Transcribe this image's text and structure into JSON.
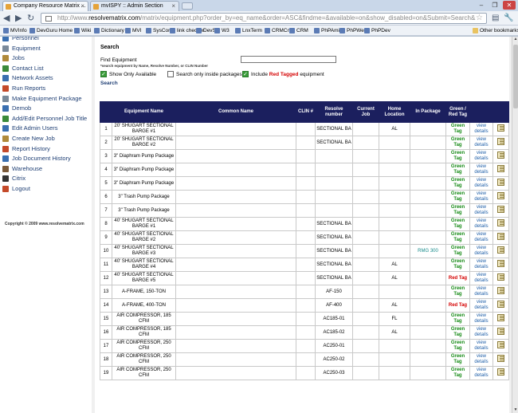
{
  "browser": {
    "tabs": [
      {
        "title": "Company Resource Matrix ..."
      },
      {
        "title": "mvISPY :: Admin Section"
      }
    ],
    "url_prefix": "http://www.",
    "url_domain": "resolvematrix.com",
    "url_rest": "/matrix/equipment.php?order_by=eq_name&order=ASC&findme=&available=on&show_disabled=on&Submit=Search&",
    "bookmarks": [
      "MVInfo",
      "DevGuru Home",
      "Wiki",
      "Dictionary",
      "MVI",
      "SysCon",
      "link checker",
      "DevSrv",
      "W3",
      "LnxTerm",
      "CRMCnt",
      "CRM",
      "PhPAmico",
      "PhPWeb1",
      "PhPDev"
    ],
    "other_bookmarks": "Other bookmarks"
  },
  "sidebar": {
    "items": [
      {
        "label": "Personnel",
        "icon": "person-icon",
        "color": "#3a6fb0"
      },
      {
        "label": "Equipment",
        "icon": "wrench-icon",
        "color": "#7a8a9a"
      },
      {
        "label": "Jobs",
        "icon": "briefcase-icon",
        "color": "#b08a3a"
      },
      {
        "label": "Contact List",
        "icon": "contact-icon",
        "color": "#3a8a3a"
      },
      {
        "label": "Network Assets",
        "icon": "network-icon",
        "color": "#3a6fb0"
      },
      {
        "label": "Run Reports",
        "icon": "report-icon",
        "color": "#c44a2a"
      },
      {
        "label": "Make Equipment Package",
        "icon": "package-icon",
        "color": "#7a8a9a"
      },
      {
        "label": "Demob",
        "icon": "demob-icon",
        "color": "#3a6fb0"
      },
      {
        "label": "Add/Edit Personnel Job Title",
        "icon": "title-icon",
        "color": "#3a8a3a"
      },
      {
        "label": "Edit Admin Users",
        "icon": "users-icon",
        "color": "#3a6fb0"
      },
      {
        "label": "Create New Job",
        "icon": "new-job-icon",
        "color": "#b08a3a"
      },
      {
        "label": "Report History",
        "icon": "history-icon",
        "color": "#c44a2a"
      },
      {
        "label": "Job Document History",
        "icon": "document-icon",
        "color": "#3a6fb0"
      },
      {
        "label": "Warehouse",
        "icon": "warehouse-icon",
        "color": "#7a5a3a"
      },
      {
        "label": "Citrix",
        "icon": "citrix-icon",
        "color": "#333333"
      },
      {
        "label": "Logout",
        "icon": "logout-icon",
        "color": "#c44a2a"
      }
    ],
    "copyright": "Copyright © 2009 www.resolvematrix.com"
  },
  "search": {
    "heading": "Search",
    "find_label": "Find Equipment",
    "find_hint": "*search equipment by Name, Resolve Number, or CLIN Number",
    "input_value": "",
    "show_only_available": "Show Only Available",
    "search_inside_packages": "Search only inside packages",
    "include_label": "Include",
    "red_tagged": "Red Tagged",
    "equipment_word": "equipment",
    "button": "Search"
  },
  "table": {
    "headers": [
      "",
      "Equipment Name",
      "Common Name",
      "CLIN #",
      "Resolve number",
      "Current Job",
      "Home Location",
      "In Package",
      "Green / Red Tag",
      "",
      ""
    ],
    "rows": [
      {
        "n": "1",
        "name": "20' SHUGART SECTIONAL BARGE #1",
        "common": "",
        "clin": "",
        "resolve": "SECTIONAL BA",
        "job": "",
        "home": "AL",
        "pkg": "",
        "tag": "Green Tag",
        "tag_color": "green"
      },
      {
        "n": "2",
        "name": "20' SHUGART SECTIONAL BARGE #2",
        "common": "",
        "clin": "",
        "resolve": "SECTIONAL BA",
        "job": "",
        "home": "",
        "pkg": "",
        "tag": "Green Tag",
        "tag_color": "green"
      },
      {
        "n": "3",
        "name": "3\" Diaphram Pump Package",
        "common": "",
        "clin": "",
        "resolve": "",
        "job": "",
        "home": "",
        "pkg": "",
        "tag": "Green Tag",
        "tag_color": "green"
      },
      {
        "n": "4",
        "name": "3\" Diaphram Pump Package",
        "common": "",
        "clin": "",
        "resolve": "",
        "job": "",
        "home": "",
        "pkg": "",
        "tag": "Green Tag",
        "tag_color": "green"
      },
      {
        "n": "5",
        "name": "3\" Diaphram Pump Package",
        "common": "",
        "clin": "",
        "resolve": "",
        "job": "",
        "home": "",
        "pkg": "",
        "tag": "Green Tag",
        "tag_color": "green"
      },
      {
        "n": "6",
        "name": "3\" Trash Pump Package",
        "common": "",
        "clin": "",
        "resolve": "",
        "job": "",
        "home": "",
        "pkg": "",
        "tag": "Green Tag",
        "tag_color": "green"
      },
      {
        "n": "7",
        "name": "3\" Trash Pump Package",
        "common": "",
        "clin": "",
        "resolve": "",
        "job": "",
        "home": "",
        "pkg": "",
        "tag": "Green Tag",
        "tag_color": "green"
      },
      {
        "n": "8",
        "name": "40' SHUGART SECTIONAL BARGE #1",
        "common": "",
        "clin": "",
        "resolve": "SECTIONAL BA",
        "job": "",
        "home": "",
        "pkg": "",
        "tag": "Green Tag",
        "tag_color": "green"
      },
      {
        "n": "9",
        "name": "40' SHUGART SECTIONAL BARGE #2",
        "common": "",
        "clin": "",
        "resolve": "SECTIONAL BA",
        "job": "",
        "home": "",
        "pkg": "",
        "tag": "Green Tag",
        "tag_color": "green"
      },
      {
        "n": "10",
        "name": "40' SHUGART SECTIONAL BARGE #3",
        "common": "",
        "clin": "",
        "resolve": "SECTIONAL BA",
        "job": "",
        "home": "",
        "pkg": "RMG 300",
        "tag": "Green Tag",
        "tag_color": "green"
      },
      {
        "n": "11",
        "name": "40' SHUGART SECTIONAL BARGE #4",
        "common": "",
        "clin": "",
        "resolve": "SECTIONAL BA",
        "job": "",
        "home": "AL",
        "pkg": "",
        "tag": "Green Tag",
        "tag_color": "green"
      },
      {
        "n": "12",
        "name": "40' SHUGART SECTIONAL BARGE #5",
        "common": "",
        "clin": "",
        "resolve": "SECTIONAL BA",
        "job": "",
        "home": "AL",
        "pkg": "",
        "tag": "Red Tag",
        "tag_color": "red"
      },
      {
        "n": "13",
        "name": "A-FRAME, 150-TON",
        "common": "",
        "clin": "",
        "resolve": "AF-150",
        "job": "",
        "home": "",
        "pkg": "",
        "tag": "Green Tag",
        "tag_color": "green"
      },
      {
        "n": "14",
        "name": "A-FRAME, 400-TON",
        "common": "",
        "clin": "",
        "resolve": "AF-400",
        "job": "",
        "home": "AL",
        "pkg": "",
        "tag": "Red Tag",
        "tag_color": "red"
      },
      {
        "n": "15",
        "name": "AIR COMPRESSOR, 185 CFM",
        "common": "",
        "clin": "",
        "resolve": "AC185-01",
        "job": "",
        "home": "FL",
        "pkg": "",
        "tag": "Green Tag",
        "tag_color": "green"
      },
      {
        "n": "16",
        "name": "AIR COMPRESSOR, 185 CFM",
        "common": "",
        "clin": "",
        "resolve": "AC185-02",
        "job": "",
        "home": "AL",
        "pkg": "",
        "tag": "Green Tag",
        "tag_color": "green"
      },
      {
        "n": "17",
        "name": "AIR COMPRESSOR, 250 CFM",
        "common": "",
        "clin": "",
        "resolve": "AC250-01",
        "job": "",
        "home": "",
        "pkg": "",
        "tag": "Green Tag",
        "tag_color": "green"
      },
      {
        "n": "18",
        "name": "AIR COMPRESSOR, 250 CFM",
        "common": "",
        "clin": "",
        "resolve": "AC250-02",
        "job": "",
        "home": "",
        "pkg": "",
        "tag": "Green Tag",
        "tag_color": "green"
      },
      {
        "n": "19",
        "name": "AIR COMPRESSOR, 250 CFM",
        "common": "",
        "clin": "",
        "resolve": "AC250-03",
        "job": "",
        "home": "",
        "pkg": "",
        "tag": "Green Tag",
        "tag_color": "green"
      }
    ],
    "view_label": "view details"
  },
  "colors": {
    "header_bg": "#1b1f5e",
    "green_tag": "#168a16",
    "red_tag": "#d40000",
    "link": "#1f5fa8"
  }
}
